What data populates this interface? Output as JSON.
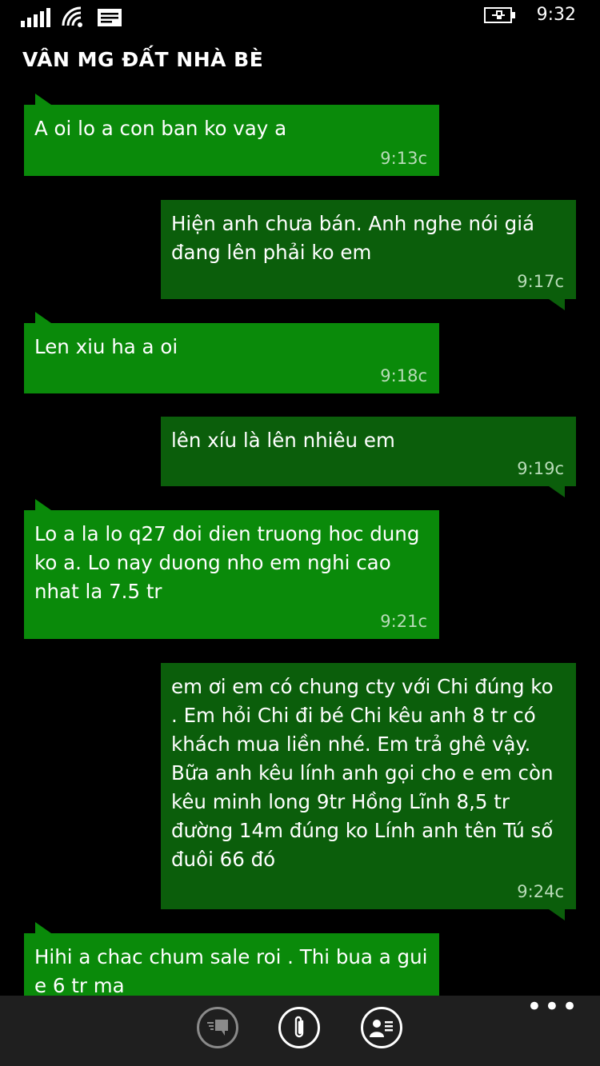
{
  "status": {
    "time": "9:32"
  },
  "conversation": {
    "title": "VÂN MG ĐẤT NHÀ BÈ"
  },
  "messages": [
    {
      "direction": "in",
      "text": "A oi lo a con ban ko vay a",
      "time": "9:13c"
    },
    {
      "direction": "out",
      "text": "Hiện anh chưa bán. Anh nghe nói giá đang lên phải ko em",
      "time": "9:17c"
    },
    {
      "direction": "in",
      "text": "Len xiu ha a oi",
      "time": "9:18c"
    },
    {
      "direction": "out",
      "text": "lên xíu là lên nhiêu em",
      "time": "9:19c"
    },
    {
      "direction": "in",
      "text": "Lo a la lo q27 doi dien truong hoc dung ko a. Lo nay duong nho em nghi cao nhat la 7.5 tr",
      "time": "9:21c"
    },
    {
      "direction": "out",
      "text": "em ơi em có chung cty với Chi đúng ko . Em hỏi Chi đi bé Chi kêu anh 8 tr có khách mua liền nhé. Em trả ghê vậy. Bữa anh kêu lính anh gọi cho e em còn kêu minh long 9tr Hồng Lĩnh 8,5 tr đường 14m đúng ko Lính anh tên Tú số đuôi 66 đó",
      "time": "9:24c"
    },
    {
      "direction": "in",
      "text": "Hihi a chac chum sale roi . Thi bua a gui e 6 tr ma",
      "time": ""
    }
  ],
  "appbar": {
    "more": "•••"
  },
  "colors": {
    "incoming": "#0a8a0a",
    "outgoing": "#0b5e0b",
    "background": "#000000"
  }
}
